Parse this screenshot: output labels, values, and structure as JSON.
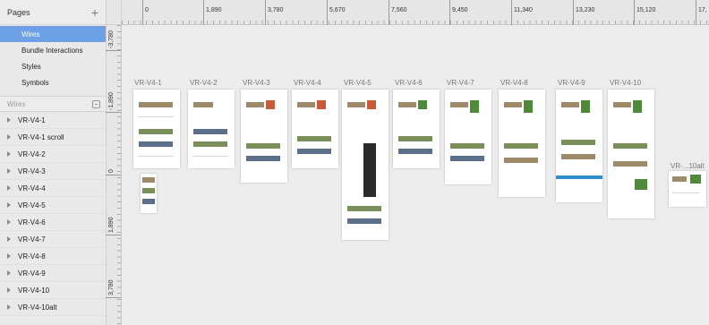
{
  "sidebar": {
    "pages_title": "Pages",
    "pages": [
      {
        "label": "Wires",
        "selected": true
      },
      {
        "label": "Bundle Interactions",
        "selected": false
      },
      {
        "label": "Styles",
        "selected": false
      },
      {
        "label": "Symbols",
        "selected": false
      }
    ],
    "section_title": "Wires",
    "artboards": [
      "VR-V4-1",
      "VR-V4-1 scroll",
      "VR-V4-2",
      "VR-V4-3",
      "VR-V4-4",
      "VR-V4-5",
      "VR-V4-6",
      "VR-V4-7",
      "VR-V4-8",
      "VR-V4-9",
      "VR-V4-10",
      "VR-V4-10alt"
    ]
  },
  "ruler_h": [
    "0",
    "1,890",
    "3,780",
    "5,670",
    "7,560",
    "9,450",
    "11,340",
    "13,230",
    "15,120",
    "17,"
  ],
  "ruler_v": [
    "-3,780",
    "-1,890",
    "0",
    "1,890",
    "3,780"
  ],
  "canvas": {
    "artboard_labels": [
      "VR-V4-1",
      "VR-V4-2",
      "VR-V4-3",
      "VR-V4-4",
      "VR-V4-5",
      "VR-V4-6",
      "VR-V4-7",
      "VR-V4-8",
      "VR-V4-9",
      "VR-V4-10",
      "VR-...10alt"
    ]
  },
  "colors": {
    "selection": "#6ea0e7",
    "accent": "#2f8dd0"
  }
}
